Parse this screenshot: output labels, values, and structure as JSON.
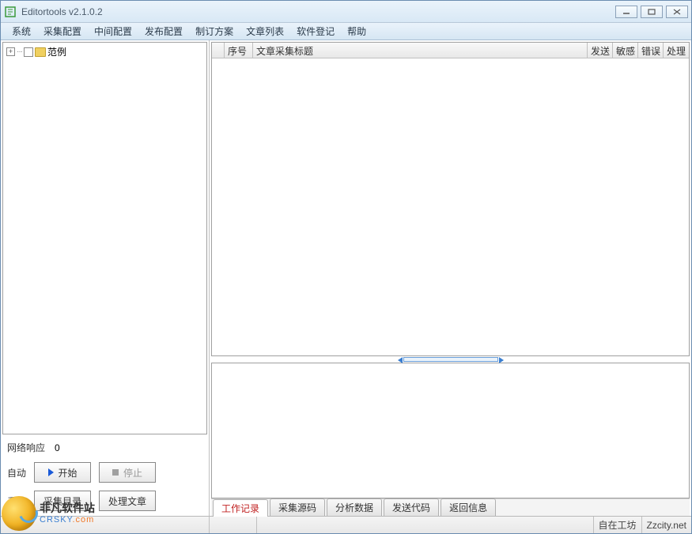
{
  "window": {
    "title": "Editortools v2.1.0.2"
  },
  "menubar": [
    "系统",
    "采集配置",
    "中间配置",
    "发布配置",
    "制订方案",
    "文章列表",
    "软件登记",
    "帮助"
  ],
  "tree": {
    "items": [
      {
        "label": "范例"
      }
    ]
  },
  "left_controls": {
    "network_label": "网络响应",
    "network_value": "0",
    "auto_label": "自动",
    "start_label": "开始",
    "stop_label": "停止",
    "manual_label": "手动",
    "collect_dir_label": "采集目录",
    "process_article_label": "处理文章"
  },
  "grid": {
    "headers": {
      "seq": "序号",
      "title": "文章采集标题",
      "send": "发送",
      "sensitive": "敏感",
      "error": "错误",
      "process": "处理"
    }
  },
  "bottom_tabs": [
    "工作记录",
    "采集源码",
    "分析数据",
    "发送代码",
    "返回信息"
  ],
  "statusbar": {
    "right_text_a": "自在工坊",
    "right_text_b": "Zzcity.net"
  },
  "watermark": {
    "cn": "非凡软件站",
    "en_a": "CRSKY",
    "en_b": ".com"
  }
}
